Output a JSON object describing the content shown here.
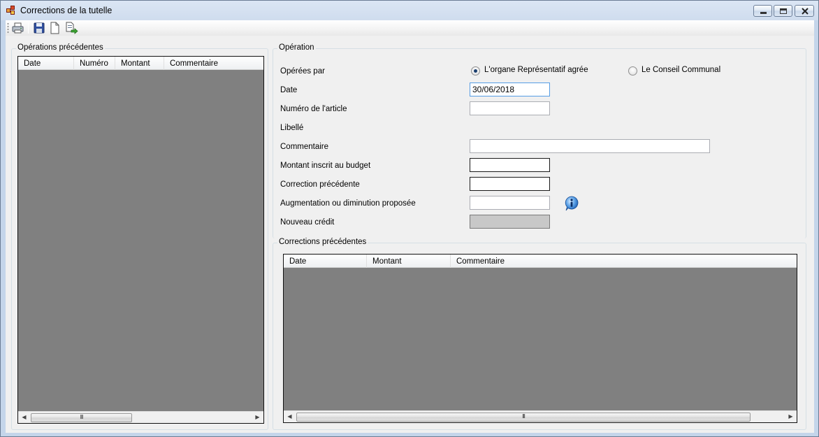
{
  "window": {
    "title": "Corrections de la tutelle"
  },
  "toolbar": {
    "buttons": [
      {
        "icon": "printer-icon"
      },
      {
        "icon": "save-icon"
      },
      {
        "icon": "new-document-icon"
      },
      {
        "icon": "export-icon"
      }
    ]
  },
  "previous_operations": {
    "title": "Opérations précédentes",
    "columns": [
      "Date",
      "Numéro",
      "Montant",
      "Commentaire"
    ],
    "rows": [],
    "scroll_thumb": "III"
  },
  "operation": {
    "title": "Opération",
    "operated_by_label": "Opérées par",
    "radio_options": [
      {
        "label": "L'organe Représentatif agrée",
        "checked": true
      },
      {
        "label": "Le Conseil Communal",
        "checked": false
      }
    ],
    "date_label": "Date",
    "date_value": "30/06/2018",
    "article_number_label": "Numéro de l'article",
    "article_number_value": "",
    "libelle_label": "Libellé",
    "comment_label": "Commentaire",
    "comment_value": "",
    "budget_amount_label": "Montant inscrit au budget",
    "budget_amount_value": "",
    "previous_correction_label": "Correction précédente",
    "previous_correction_value": "",
    "proposed_change_label": "Augmentation ou diminution proposée",
    "proposed_change_value": "",
    "new_credit_label": "Nouveau crédit",
    "new_credit_value": ""
  },
  "previous_corrections": {
    "title": "Corrections précédentes",
    "columns": [
      "Date",
      "Montant",
      "Commentaire"
    ],
    "rows": [],
    "scroll_thumb": "III"
  },
  "colors": {
    "grid_background": "#808080",
    "client_background": "#f0f0f0",
    "focus_border": "#569de5"
  }
}
